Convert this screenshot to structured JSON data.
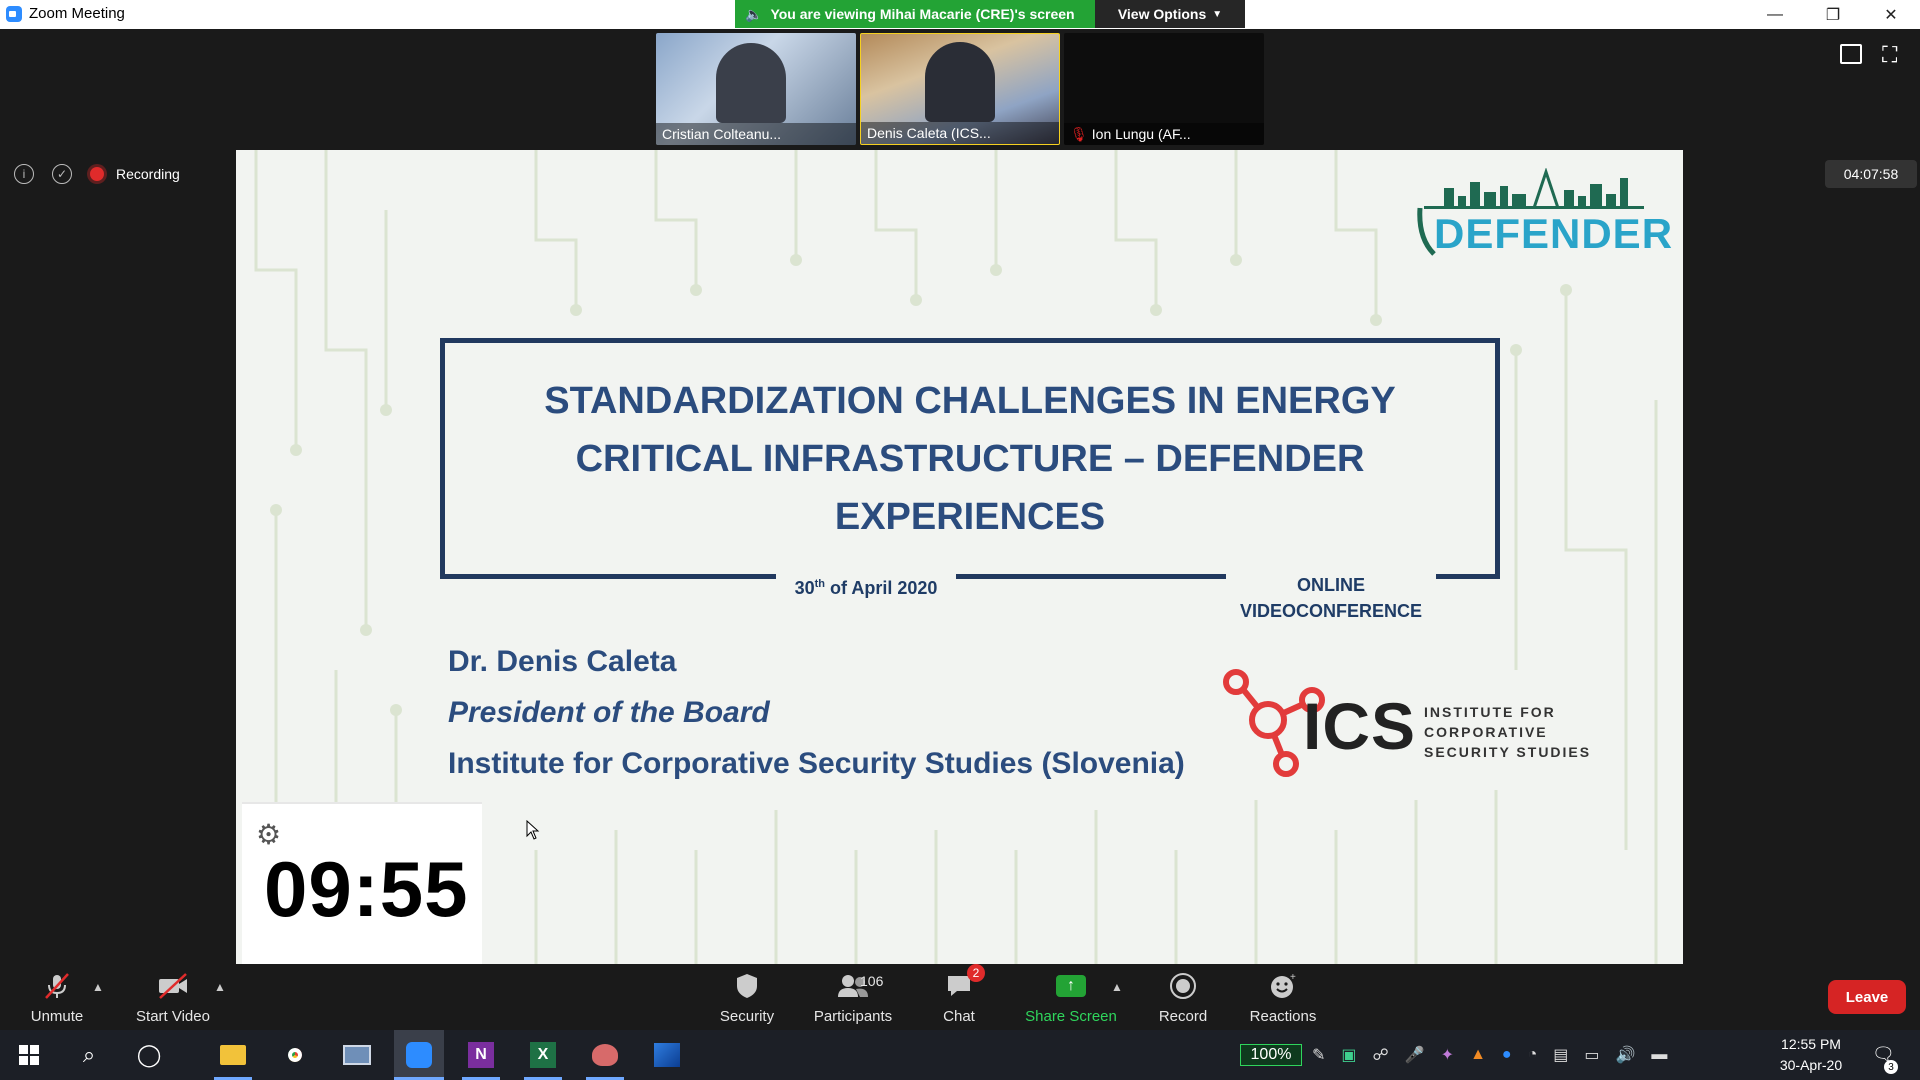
{
  "window": {
    "title": "Zoom Meeting",
    "controls": [
      "—",
      "❐",
      "✕"
    ]
  },
  "banner": {
    "viewing_text": "You are viewing Mihai Macarie (CRE)'s screen",
    "view_options": "View Options"
  },
  "participants_strip": [
    {
      "name": "Cristian Colteanu..."
    },
    {
      "name": "Denis Caleta (ICS..."
    },
    {
      "name": "Ion Lungu (AF..."
    }
  ],
  "meeting_timer": "04:07:58",
  "recording_label": "Recording",
  "slide": {
    "logo_text": "DEFENDER",
    "title_lines": [
      "STANDARDIZATION CHALLENGES IN ENERGY",
      "CRITICAL INFRASTRUCTURE – DEFENDER",
      "EXPERIENCES"
    ],
    "date_day": "30",
    "date_sup": "th",
    "date_rest": " of April 2020",
    "online_line1": "ONLINE",
    "online_line2": "VIDEOCONFERENCE",
    "speaker_name": "Dr. Denis Caleta",
    "speaker_role": "President of the Board",
    "speaker_org": "Institute for Corporative Security Studies  (Slovenia)",
    "ics_big": "ICS",
    "ics_sub_lines": [
      "INSTITUTE FOR",
      "CORPORATIVE",
      "SECURITY STUDIES"
    ]
  },
  "countdown": "09:55",
  "toolbar": {
    "unmute": "Unmute",
    "start_video": "Start Video",
    "security": "Security",
    "participants": "Participants",
    "participants_count": "106",
    "chat": "Chat",
    "chat_badge": "2",
    "share_screen": "Share Screen",
    "record": "Record",
    "reactions": "Reactions",
    "leave": "Leave"
  },
  "taskbar": {
    "battery": "100%",
    "time": "12:55 PM",
    "date": "30-Apr-20",
    "notification_count": "3"
  },
  "colors": {
    "share_green": "#23a335",
    "leave_red": "#d62424",
    "slide_blue": "#2b4c7e"
  }
}
